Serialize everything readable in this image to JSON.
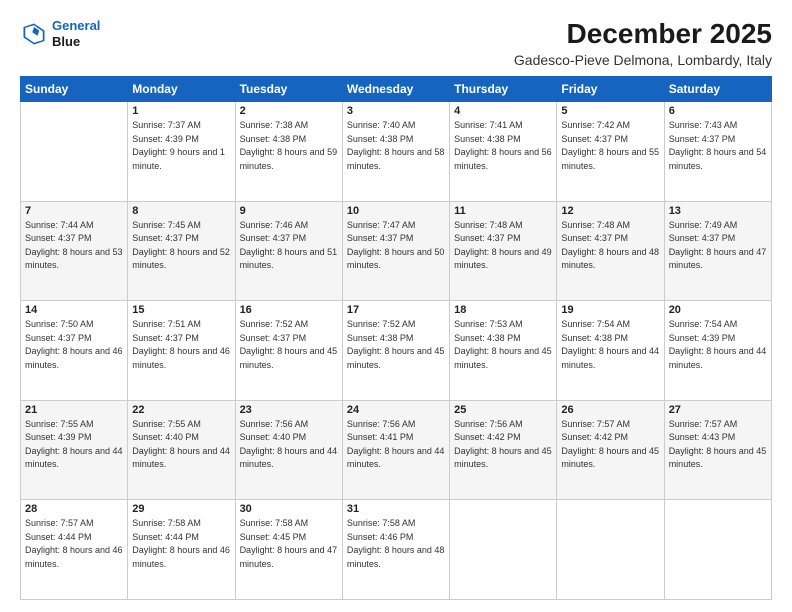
{
  "logo": {
    "line1": "General",
    "line2": "Blue"
  },
  "title": "December 2025",
  "subtitle": "Gadesco-Pieve Delmona, Lombardy, Italy",
  "header_days": [
    "Sunday",
    "Monday",
    "Tuesday",
    "Wednesday",
    "Thursday",
    "Friday",
    "Saturday"
  ],
  "weeks": [
    [
      {
        "day": "",
        "sunrise": "",
        "sunset": "",
        "daylight": ""
      },
      {
        "day": "1",
        "sunrise": "Sunrise: 7:37 AM",
        "sunset": "Sunset: 4:39 PM",
        "daylight": "Daylight: 9 hours and 1 minute."
      },
      {
        "day": "2",
        "sunrise": "Sunrise: 7:38 AM",
        "sunset": "Sunset: 4:38 PM",
        "daylight": "Daylight: 8 hours and 59 minutes."
      },
      {
        "day": "3",
        "sunrise": "Sunrise: 7:40 AM",
        "sunset": "Sunset: 4:38 PM",
        "daylight": "Daylight: 8 hours and 58 minutes."
      },
      {
        "day": "4",
        "sunrise": "Sunrise: 7:41 AM",
        "sunset": "Sunset: 4:38 PM",
        "daylight": "Daylight: 8 hours and 56 minutes."
      },
      {
        "day": "5",
        "sunrise": "Sunrise: 7:42 AM",
        "sunset": "Sunset: 4:37 PM",
        "daylight": "Daylight: 8 hours and 55 minutes."
      },
      {
        "day": "6",
        "sunrise": "Sunrise: 7:43 AM",
        "sunset": "Sunset: 4:37 PM",
        "daylight": "Daylight: 8 hours and 54 minutes."
      }
    ],
    [
      {
        "day": "7",
        "sunrise": "Sunrise: 7:44 AM",
        "sunset": "Sunset: 4:37 PM",
        "daylight": "Daylight: 8 hours and 53 minutes."
      },
      {
        "day": "8",
        "sunrise": "Sunrise: 7:45 AM",
        "sunset": "Sunset: 4:37 PM",
        "daylight": "Daylight: 8 hours and 52 minutes."
      },
      {
        "day": "9",
        "sunrise": "Sunrise: 7:46 AM",
        "sunset": "Sunset: 4:37 PM",
        "daylight": "Daylight: 8 hours and 51 minutes."
      },
      {
        "day": "10",
        "sunrise": "Sunrise: 7:47 AM",
        "sunset": "Sunset: 4:37 PM",
        "daylight": "Daylight: 8 hours and 50 minutes."
      },
      {
        "day": "11",
        "sunrise": "Sunrise: 7:48 AM",
        "sunset": "Sunset: 4:37 PM",
        "daylight": "Daylight: 8 hours and 49 minutes."
      },
      {
        "day": "12",
        "sunrise": "Sunrise: 7:48 AM",
        "sunset": "Sunset: 4:37 PM",
        "daylight": "Daylight: 8 hours and 48 minutes."
      },
      {
        "day": "13",
        "sunrise": "Sunrise: 7:49 AM",
        "sunset": "Sunset: 4:37 PM",
        "daylight": "Daylight: 8 hours and 47 minutes."
      }
    ],
    [
      {
        "day": "14",
        "sunrise": "Sunrise: 7:50 AM",
        "sunset": "Sunset: 4:37 PM",
        "daylight": "Daylight: 8 hours and 46 minutes."
      },
      {
        "day": "15",
        "sunrise": "Sunrise: 7:51 AM",
        "sunset": "Sunset: 4:37 PM",
        "daylight": "Daylight: 8 hours and 46 minutes."
      },
      {
        "day": "16",
        "sunrise": "Sunrise: 7:52 AM",
        "sunset": "Sunset: 4:37 PM",
        "daylight": "Daylight: 8 hours and 45 minutes."
      },
      {
        "day": "17",
        "sunrise": "Sunrise: 7:52 AM",
        "sunset": "Sunset: 4:38 PM",
        "daylight": "Daylight: 8 hours and 45 minutes."
      },
      {
        "day": "18",
        "sunrise": "Sunrise: 7:53 AM",
        "sunset": "Sunset: 4:38 PM",
        "daylight": "Daylight: 8 hours and 45 minutes."
      },
      {
        "day": "19",
        "sunrise": "Sunrise: 7:54 AM",
        "sunset": "Sunset: 4:38 PM",
        "daylight": "Daylight: 8 hours and 44 minutes."
      },
      {
        "day": "20",
        "sunrise": "Sunrise: 7:54 AM",
        "sunset": "Sunset: 4:39 PM",
        "daylight": "Daylight: 8 hours and 44 minutes."
      }
    ],
    [
      {
        "day": "21",
        "sunrise": "Sunrise: 7:55 AM",
        "sunset": "Sunset: 4:39 PM",
        "daylight": "Daylight: 8 hours and 44 minutes."
      },
      {
        "day": "22",
        "sunrise": "Sunrise: 7:55 AM",
        "sunset": "Sunset: 4:40 PM",
        "daylight": "Daylight: 8 hours and 44 minutes."
      },
      {
        "day": "23",
        "sunrise": "Sunrise: 7:56 AM",
        "sunset": "Sunset: 4:40 PM",
        "daylight": "Daylight: 8 hours and 44 minutes."
      },
      {
        "day": "24",
        "sunrise": "Sunrise: 7:56 AM",
        "sunset": "Sunset: 4:41 PM",
        "daylight": "Daylight: 8 hours and 44 minutes."
      },
      {
        "day": "25",
        "sunrise": "Sunrise: 7:56 AM",
        "sunset": "Sunset: 4:42 PM",
        "daylight": "Daylight: 8 hours and 45 minutes."
      },
      {
        "day": "26",
        "sunrise": "Sunrise: 7:57 AM",
        "sunset": "Sunset: 4:42 PM",
        "daylight": "Daylight: 8 hours and 45 minutes."
      },
      {
        "day": "27",
        "sunrise": "Sunrise: 7:57 AM",
        "sunset": "Sunset: 4:43 PM",
        "daylight": "Daylight: 8 hours and 45 minutes."
      }
    ],
    [
      {
        "day": "28",
        "sunrise": "Sunrise: 7:57 AM",
        "sunset": "Sunset: 4:44 PM",
        "daylight": "Daylight: 8 hours and 46 minutes."
      },
      {
        "day": "29",
        "sunrise": "Sunrise: 7:58 AM",
        "sunset": "Sunset: 4:44 PM",
        "daylight": "Daylight: 8 hours and 46 minutes."
      },
      {
        "day": "30",
        "sunrise": "Sunrise: 7:58 AM",
        "sunset": "Sunset: 4:45 PM",
        "daylight": "Daylight: 8 hours and 47 minutes."
      },
      {
        "day": "31",
        "sunrise": "Sunrise: 7:58 AM",
        "sunset": "Sunset: 4:46 PM",
        "daylight": "Daylight: 8 hours and 48 minutes."
      },
      {
        "day": "",
        "sunrise": "",
        "sunset": "",
        "daylight": ""
      },
      {
        "day": "",
        "sunrise": "",
        "sunset": "",
        "daylight": ""
      },
      {
        "day": "",
        "sunrise": "",
        "sunset": "",
        "daylight": ""
      }
    ]
  ]
}
